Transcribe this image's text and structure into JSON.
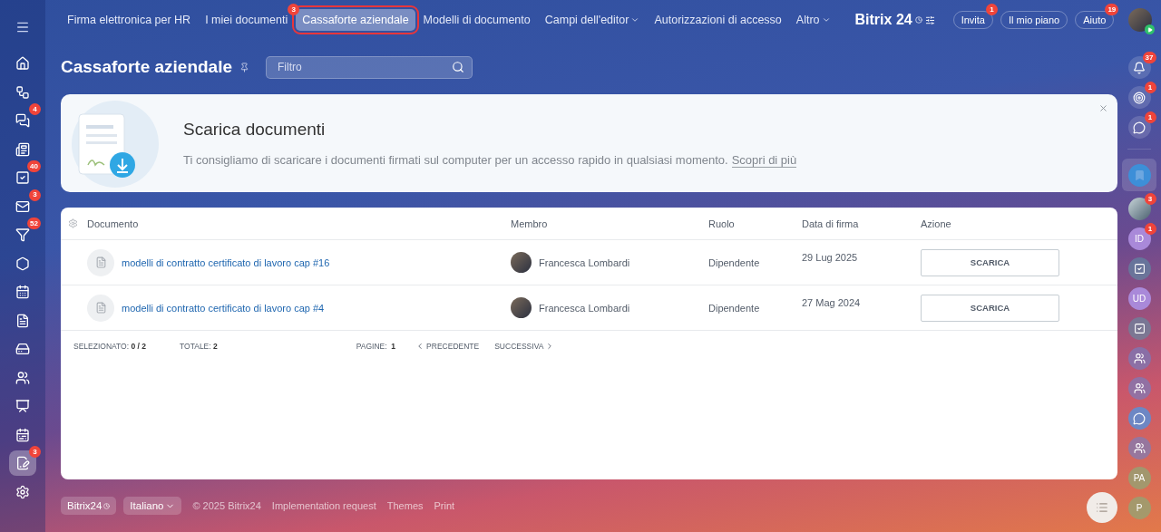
{
  "top_nav": {
    "items": [
      {
        "label": "Firma elettronica per HR",
        "selected": false
      },
      {
        "label": "I miei documenti",
        "selected": false
      },
      {
        "label": "Cassaforte aziendale",
        "selected": true,
        "badge": "3"
      },
      {
        "label": "Modelli di documento",
        "selected": false
      },
      {
        "label": "Campi dell'editor",
        "selected": false,
        "dropdown": true
      },
      {
        "label": "Autorizzazioni di accesso",
        "selected": false
      },
      {
        "label": "Altro",
        "selected": false,
        "dropdown": true
      }
    ],
    "logo": {
      "name": "Bitrix",
      "suffix": "24"
    },
    "buttons": [
      {
        "label": "Invita",
        "badge": "1"
      },
      {
        "label": "Il mio piano"
      },
      {
        "label": "Aiuto",
        "badge": "19"
      }
    ]
  },
  "left_sidebar": [
    {
      "kind": "home",
      "selected": false
    },
    {
      "kind": "flow",
      "selected": false
    },
    {
      "kind": "chat",
      "badge": "4",
      "selected": false
    },
    {
      "kind": "news",
      "selected": false
    },
    {
      "kind": "tasks",
      "badge": "40",
      "selected": false
    },
    {
      "kind": "mail",
      "badge": "3",
      "selected": false
    },
    {
      "kind": "funnel",
      "badge": "52",
      "selected": false
    },
    {
      "kind": "hexagon",
      "selected": false
    },
    {
      "kind": "calendar",
      "selected": false
    },
    {
      "kind": "doc",
      "selected": false
    },
    {
      "kind": "drive",
      "selected": false
    },
    {
      "kind": "users",
      "selected": false
    },
    {
      "kind": "board",
      "selected": false
    },
    {
      "kind": "schedule",
      "selected": false
    },
    {
      "kind": "sign",
      "badge": "3",
      "selected": true
    },
    {
      "kind": "settings",
      "selected": false
    }
  ],
  "right_sidebar": [
    {
      "kind": "bell",
      "badge": "37",
      "selected": false
    },
    {
      "kind": "target",
      "badge": "1",
      "selected": false
    },
    {
      "kind": "chat",
      "badge": "1",
      "selected": false
    },
    {
      "kind": "bookmark",
      "selected": true
    },
    {
      "kind": "photo",
      "badge": "3",
      "selected": false
    },
    {
      "kind": "initials",
      "text": "ID",
      "badge": "1",
      "selected": false
    },
    {
      "kind": "task",
      "selected": false
    },
    {
      "kind": "initials",
      "text": "UD",
      "selected": false
    },
    {
      "kind": "task",
      "selected": false
    },
    {
      "kind": "group",
      "selected": false
    },
    {
      "kind": "group",
      "selected": false
    },
    {
      "kind": "chat",
      "selected": false
    },
    {
      "kind": "group",
      "selected": false
    },
    {
      "kind": "initials",
      "text": "PA",
      "selected": false
    },
    {
      "kind": "initials",
      "text": "P",
      "selected": false
    }
  ],
  "page": {
    "title": "Cassaforte aziendale",
    "filter": {
      "placeholder": "Filtro"
    }
  },
  "banner": {
    "title": "Scarica documenti",
    "text": "Ti consigliamo di scaricare i documenti firmati sul computer per un accesso rapido in qualsiasi momento.",
    "link": "Scopri di più"
  },
  "table": {
    "columns": [
      "Documento",
      "Membro",
      "Ruolo",
      "Data di firma",
      "Azione"
    ],
    "rows": [
      {
        "document": "modelli di contratto certificato di lavoro cap #16",
        "member": "Francesca Lombardi",
        "role": "Dipendente",
        "date": "29 Lug 2025",
        "action": "SCARICA"
      },
      {
        "document": "modelli di contratto certificato di lavoro cap #4",
        "member": "Francesca Lombardi",
        "role": "Dipendente",
        "date": "27 Mag 2024",
        "action": "SCARICA"
      }
    ],
    "footer": {
      "selected_label": "SELEZIONATO:",
      "selected_value": "0 / 2",
      "total_label": "TOTALE:",
      "total_value": "2",
      "pages_label": "PAGINE:",
      "pages_value": "1",
      "prev": "PRECEDENTE",
      "next": "SUCCESSIVA"
    }
  },
  "footer": {
    "logo": "Bitrix24",
    "language": "Italiano",
    "links": [
      "© 2025 Bitrix24",
      "Implementation request",
      "Themes",
      "Print"
    ]
  }
}
